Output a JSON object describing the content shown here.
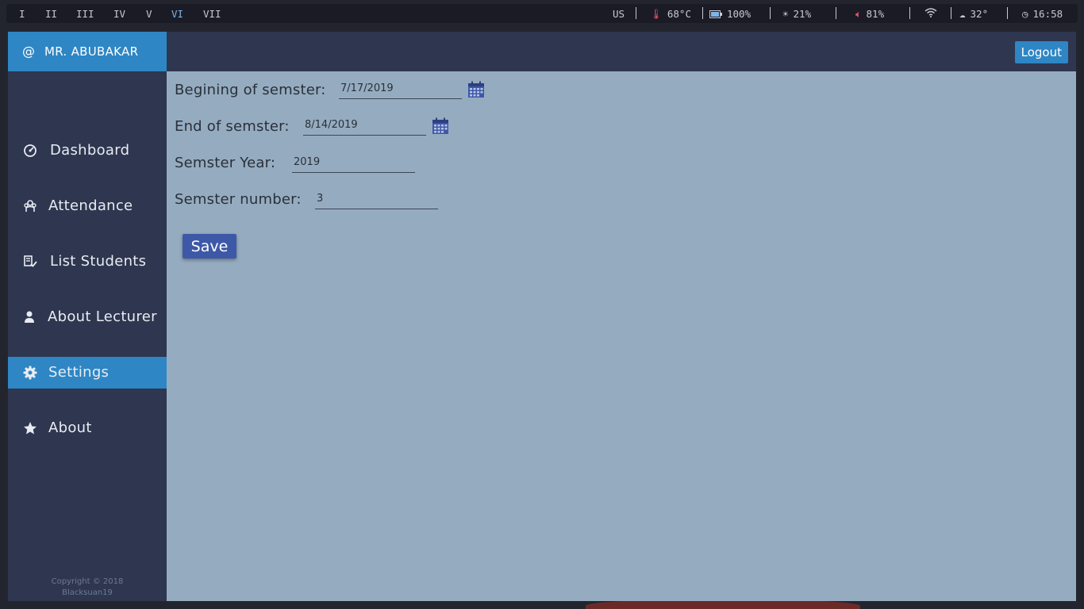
{
  "topbar": {
    "workspaces": [
      "I",
      "II",
      "III",
      "IV",
      "V",
      "VI",
      "VII"
    ],
    "active_workspace": "VI",
    "keyboard": "US",
    "temperature": "68°C",
    "battery": "100%",
    "brightness": "21%",
    "volume": "81%",
    "weather": "32°",
    "clock": "16:58"
  },
  "sidebar": {
    "user": "MR. ABUBAKAR",
    "items": [
      {
        "label": "Dashboard",
        "icon": "dashboard-icon"
      },
      {
        "label": "Attendance",
        "icon": "attendance-icon"
      },
      {
        "label": "List Students",
        "icon": "list-students-icon"
      },
      {
        "label": "About Lecturer",
        "icon": "user-icon"
      },
      {
        "label": "Settings",
        "icon": "gear-icon"
      },
      {
        "label": "About",
        "icon": "star-icon"
      }
    ],
    "active": "Settings",
    "copyright_line1": "Copyright © 2018",
    "copyright_line2": "Blacksuan19"
  },
  "header": {
    "logout_label": "Logout"
  },
  "form": {
    "begin_label": "Begining of semster:",
    "begin_value": "7/17/2019",
    "end_label": "End of semster:",
    "end_value": "8/14/2019",
    "year_label": "Semster Year:",
    "year_value": "2019",
    "number_label": "Semster number:",
    "number_value": "3",
    "save_label": "Save"
  },
  "colors": {
    "accent": "#2e86c4",
    "sidebar": "#2e3650",
    "content": "#95acc0",
    "button": "#3e58a8"
  }
}
